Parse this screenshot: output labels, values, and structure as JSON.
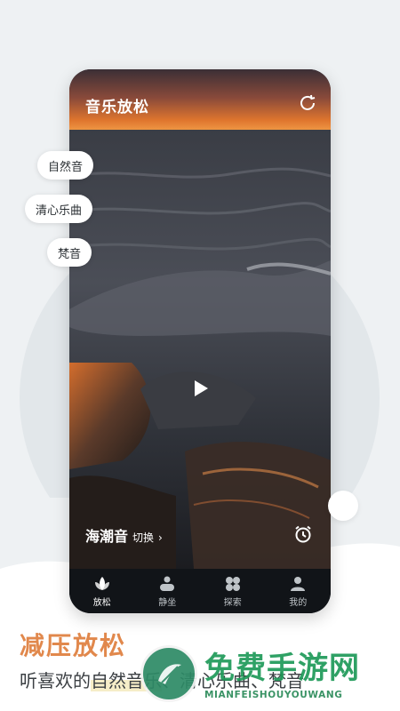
{
  "app": {
    "title": "音乐放松"
  },
  "categories": [
    {
      "label": "自然音"
    },
    {
      "label": "清心乐曲"
    },
    {
      "label": "梵音"
    }
  ],
  "player": {
    "track_name": "海潮音",
    "switch_label": "切换",
    "chevron": "›",
    "icons": {
      "refresh": "refresh-icon",
      "play": "play-icon",
      "timer": "alarm-clock-icon"
    }
  },
  "tabs": [
    {
      "label": "放松",
      "icon": "lotus-icon",
      "active": true
    },
    {
      "label": "静坐",
      "icon": "meditate-icon",
      "active": false
    },
    {
      "label": "探索",
      "icon": "explore-icon",
      "active": false
    },
    {
      "label": "我的",
      "icon": "user-icon",
      "active": false
    }
  ],
  "promo": {
    "headline": "减压放松",
    "sub_prefix": "听喜欢的",
    "sub_highlight": "自然音乐",
    "sub_suffix": "、清心乐曲、梵音"
  },
  "watermark": {
    "title": "免费手游网",
    "subtitle": "MIANFEISHOUYOUWANG"
  },
  "colors": {
    "accent": "#e1884c",
    "watermark_green": "#1e9a58",
    "background": "#eef1f3"
  }
}
